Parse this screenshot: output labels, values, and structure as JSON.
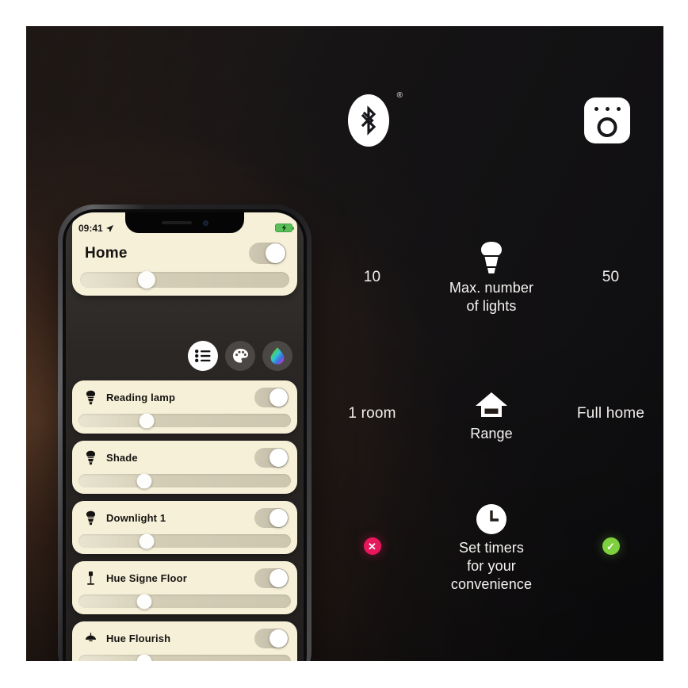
{
  "hero": {
    "top_icons": {
      "bluetooth": {
        "name": "bluetooth-icon",
        "registered_mark": "®"
      },
      "bridge": {
        "name": "hue-bridge-icon"
      }
    },
    "features": [
      {
        "id": "max-lights",
        "icon": "bulb-icon",
        "label": "Max. number\nof lights",
        "label_line1": "Max. number",
        "label_line2": "of lights",
        "left_value": "10",
        "right_value": "50"
      },
      {
        "id": "range",
        "icon": "house-icon",
        "label": "Range",
        "label_line1": "Range",
        "label_line2": "",
        "left_value": "1 room",
        "right_value": "Full home"
      },
      {
        "id": "timers",
        "icon": "clock-icon",
        "label": "Set timers for your convenience",
        "label_line1": "Set timers",
        "label_line2": "for your",
        "label_line3": "convenience",
        "left_value": "✕",
        "right_value": "✓"
      }
    ],
    "colors": {
      "glow": "#a86a42",
      "background": "#131214",
      "badge_x": "#e8175d",
      "badge_ok": "#7ed03f"
    }
  },
  "phone": {
    "status_bar": {
      "time": "09:41",
      "location_icon": "location-arrow-icon",
      "battery_icon": "battery-charging-icon"
    },
    "home_card": {
      "title": "Home",
      "toggle_on": true,
      "brightness_percent": 32
    },
    "mode_buttons": [
      {
        "id": "list",
        "icon": "list-icon",
        "active": true
      },
      {
        "id": "scenes",
        "icon": "palette-icon",
        "active": false
      },
      {
        "id": "color",
        "icon": "color-drop-icon",
        "active": false
      }
    ],
    "lights": [
      {
        "name": "Reading lamp",
        "icon": "spot-bulb-icon",
        "toggle_on": true,
        "brightness_percent": 32
      },
      {
        "name": "Shade",
        "icon": "spot-bulb-icon",
        "toggle_on": true,
        "brightness_percent": 31
      },
      {
        "name": "Downlight 1",
        "icon": "spot-bulb-icon",
        "toggle_on": true,
        "brightness_percent": 32
      },
      {
        "name": "Hue Signe Floor",
        "icon": "floor-lamp-icon",
        "toggle_on": true,
        "brightness_percent": 31
      },
      {
        "name": "Hue Flourish",
        "icon": "pendant-lamp-icon",
        "toggle_on": true,
        "brightness_percent": 31
      }
    ],
    "colors": {
      "card": "#f6f0d8",
      "screen": "#2c2a29"
    }
  }
}
